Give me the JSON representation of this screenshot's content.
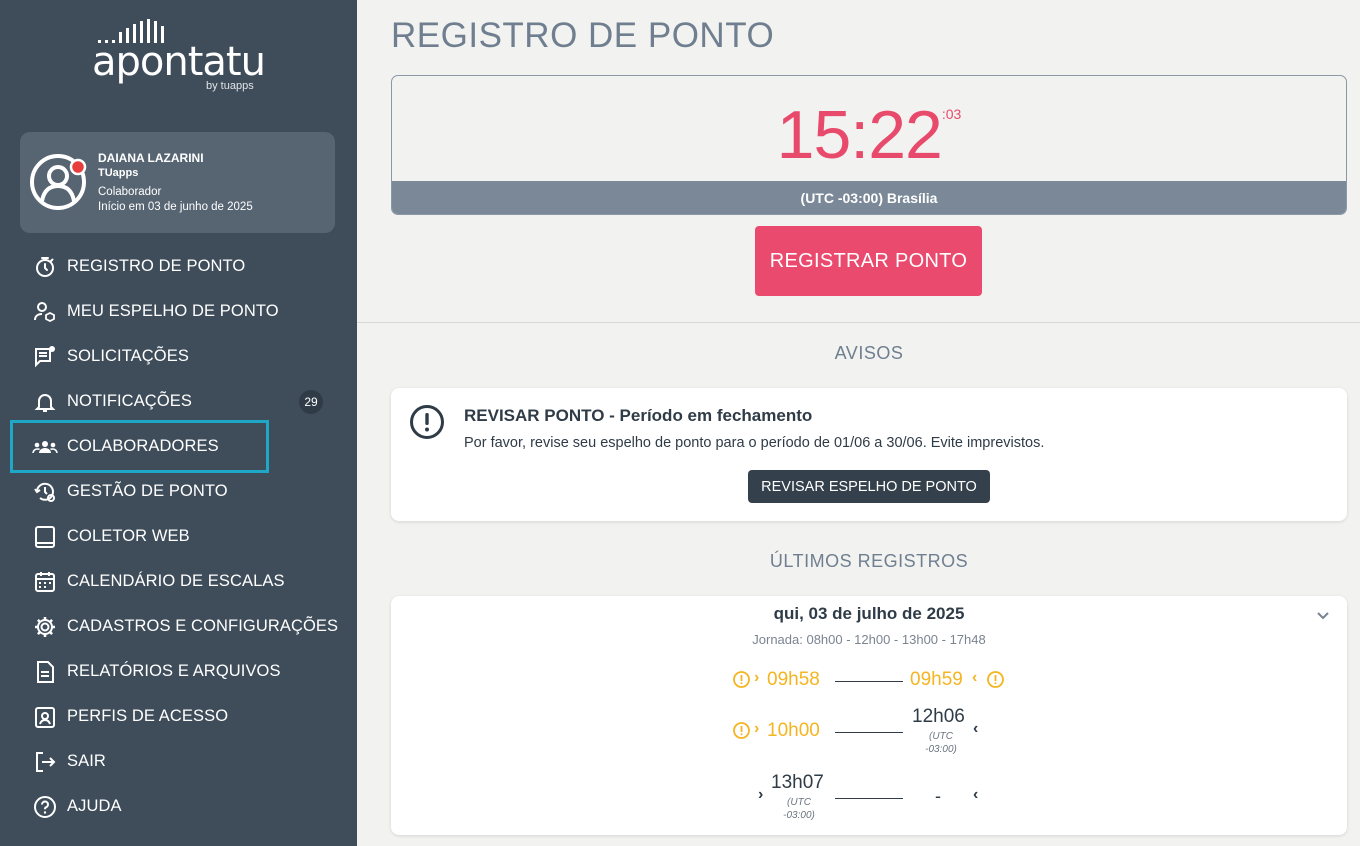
{
  "brand": {
    "logo_text": "apontatu",
    "logo_by": "by tuapps"
  },
  "user": {
    "name": "DAIANA LAZARINI",
    "company": "TUapps",
    "role": "Colaborador",
    "since": "Início em 03 de junho de 2025"
  },
  "menu": [
    {
      "label": "REGISTRO DE PONTO",
      "icon": "stopwatch-icon"
    },
    {
      "label": "MEU ESPELHO DE PONTO",
      "icon": "user-cube-icon"
    },
    {
      "label": "SOLICITAÇÕES",
      "icon": "message-alert-icon"
    },
    {
      "label": "NOTIFICAÇÕES",
      "icon": "bell-icon",
      "badge": "29"
    },
    {
      "label": "COLABORADORES",
      "icon": "users-icon"
    },
    {
      "label": "GESTÃO DE PONTO",
      "icon": "history-gear-icon"
    },
    {
      "label": "COLETOR WEB",
      "icon": "tablet-icon"
    },
    {
      "label": "CALENDÁRIO DE ESCALAS",
      "icon": "calendar-icon"
    },
    {
      "label": "CADASTROS E CONFIGURAÇÕES",
      "icon": "gear-icon"
    },
    {
      "label": "RELATÓRIOS E ARQUIVOS",
      "icon": "document-icon"
    },
    {
      "label": "PERFIS DE ACESSO",
      "icon": "id-badge-icon"
    },
    {
      "label": "SAIR",
      "icon": "logout-icon"
    },
    {
      "label": "AJUDA",
      "icon": "help-icon"
    }
  ],
  "page": {
    "title": "REGISTRO DE PONTO"
  },
  "clock": {
    "hm": "15:22",
    "sec": ":03",
    "timezone": "(UTC -03:00) Brasília"
  },
  "register_button": "REGISTRAR PONTO",
  "notices": {
    "section_title": "AVISOS",
    "title": "REVISAR PONTO - Período em fechamento",
    "text": "Por favor, revise seu espelho de ponto para o período de 01/06 a 30/06. Evite imprevistos.",
    "button": "REVISAR ESPELHO DE PONTO"
  },
  "records": {
    "section_title": "ÚLTIMOS REGISTROS",
    "date": "qui, 03 de julho de 2025",
    "journey": "Jornada: 08h00 - 12h00 - 13h00 - 17h48",
    "rows": [
      {
        "in": "09h58",
        "out": "09h59"
      },
      {
        "in": "10h00",
        "out": "12h06",
        "out_tz_1": "(UTC",
        "out_tz_2": "-03:00)"
      },
      {
        "in": "13h07",
        "in_tz_1": "(UTC",
        "in_tz_2": "-03:00)",
        "out": "-"
      }
    ]
  },
  "colors": {
    "sidebar": "#3f4d5a",
    "accent": "#ea4a6d",
    "warning": "#f4b520",
    "highlight": "#1ea7c7"
  }
}
